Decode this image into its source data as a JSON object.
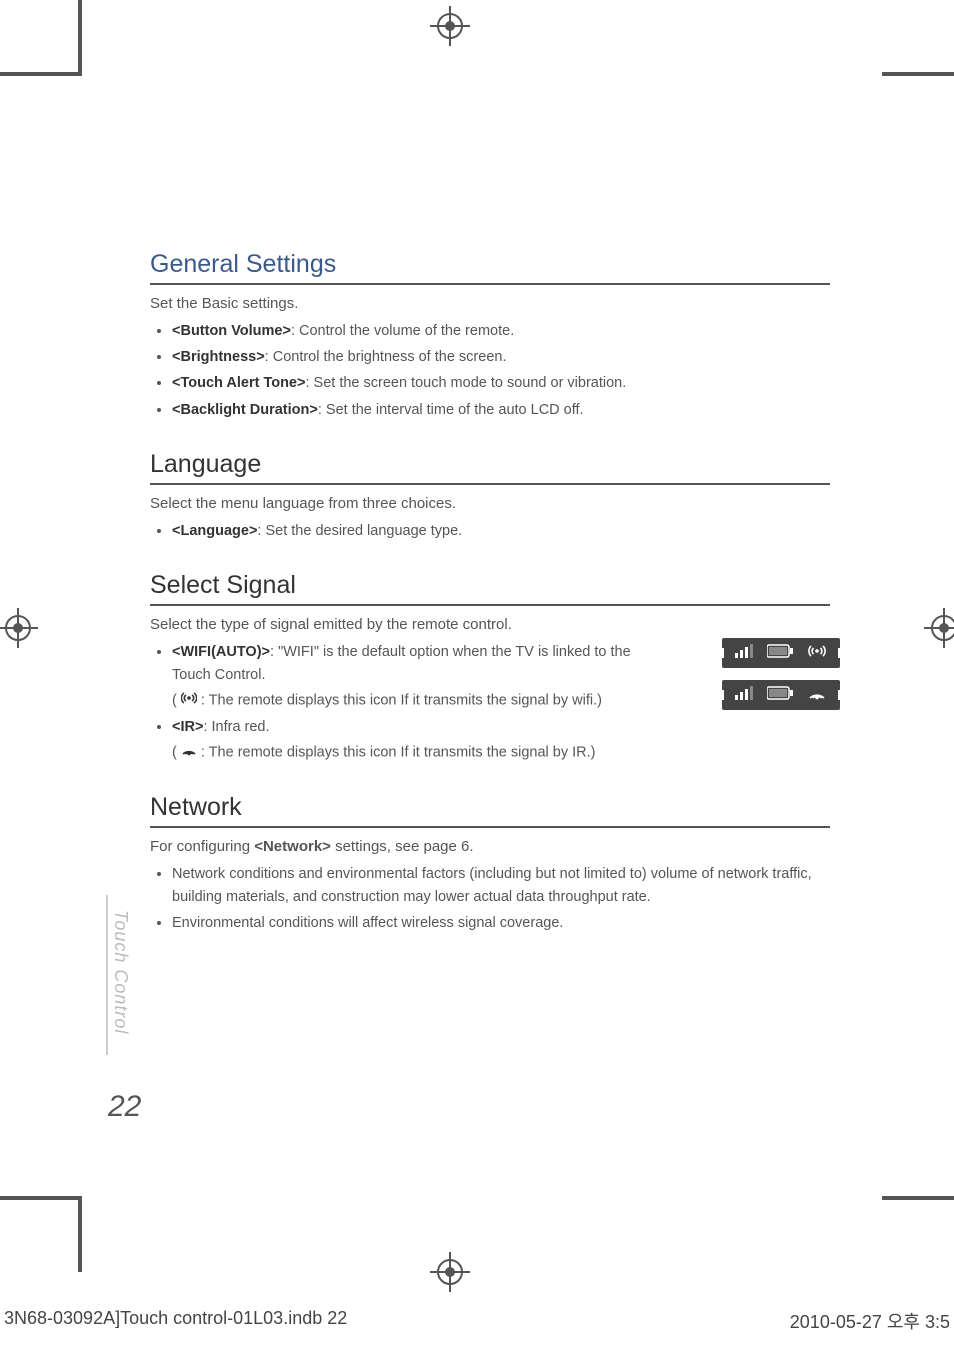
{
  "sections": {
    "general": {
      "title": "General Settings",
      "intro": "Set the Basic settings.",
      "items": [
        {
          "label": "<Button Volume>",
          "rest": ": Control the volume of the remote."
        },
        {
          "label": "<Brightness>",
          "rest": ": Control the brightness of the screen."
        },
        {
          "label": "<Touch Alert Tone>",
          "rest": ": Set the screen touch mode to sound or vibration."
        },
        {
          "label": "<Backlight Duration>",
          "rest": ": Set the interval time of the auto LCD off."
        }
      ]
    },
    "language": {
      "title": "Language",
      "intro": "Select the menu language from three choices.",
      "items": [
        {
          "label": "<Language>",
          "rest": ": Set the desired language type."
        }
      ]
    },
    "select_signal": {
      "title": "Select Signal",
      "intro": "Select the type of signal emitted by the remote control.",
      "wifi": {
        "label": "<WIFI(AUTO)>",
        "rest": ": \"WIFI\" is the default option when the TV is linked to the Touch Control.",
        "sub_before": "( ",
        "sub_after": " : The remote displays this icon If it transmits the signal by wifi.)"
      },
      "ir": {
        "label": "<IR>",
        "rest": ": Infra red.",
        "sub_before": "( ",
        "sub_after": " : The remote displays this icon If it transmits the signal by IR.)"
      }
    },
    "network": {
      "title": "Network",
      "intro_before": "For configuring ",
      "intro_bold": "<Network>",
      "intro_after": " settings, see page 6.",
      "items": [
        "Network conditions and environmental factors (including but not limited to) volume of network traffic, building materials, and construction may lower actual data throughput rate.",
        "Environmental conditions will affect wireless signal coverage."
      ]
    }
  },
  "side_label": "Touch Control",
  "page_number": "22",
  "footer": {
    "left": "3N68-03092A]Touch control-01L03.indb   22",
    "right": "2010-05-27   오후 3:5"
  }
}
